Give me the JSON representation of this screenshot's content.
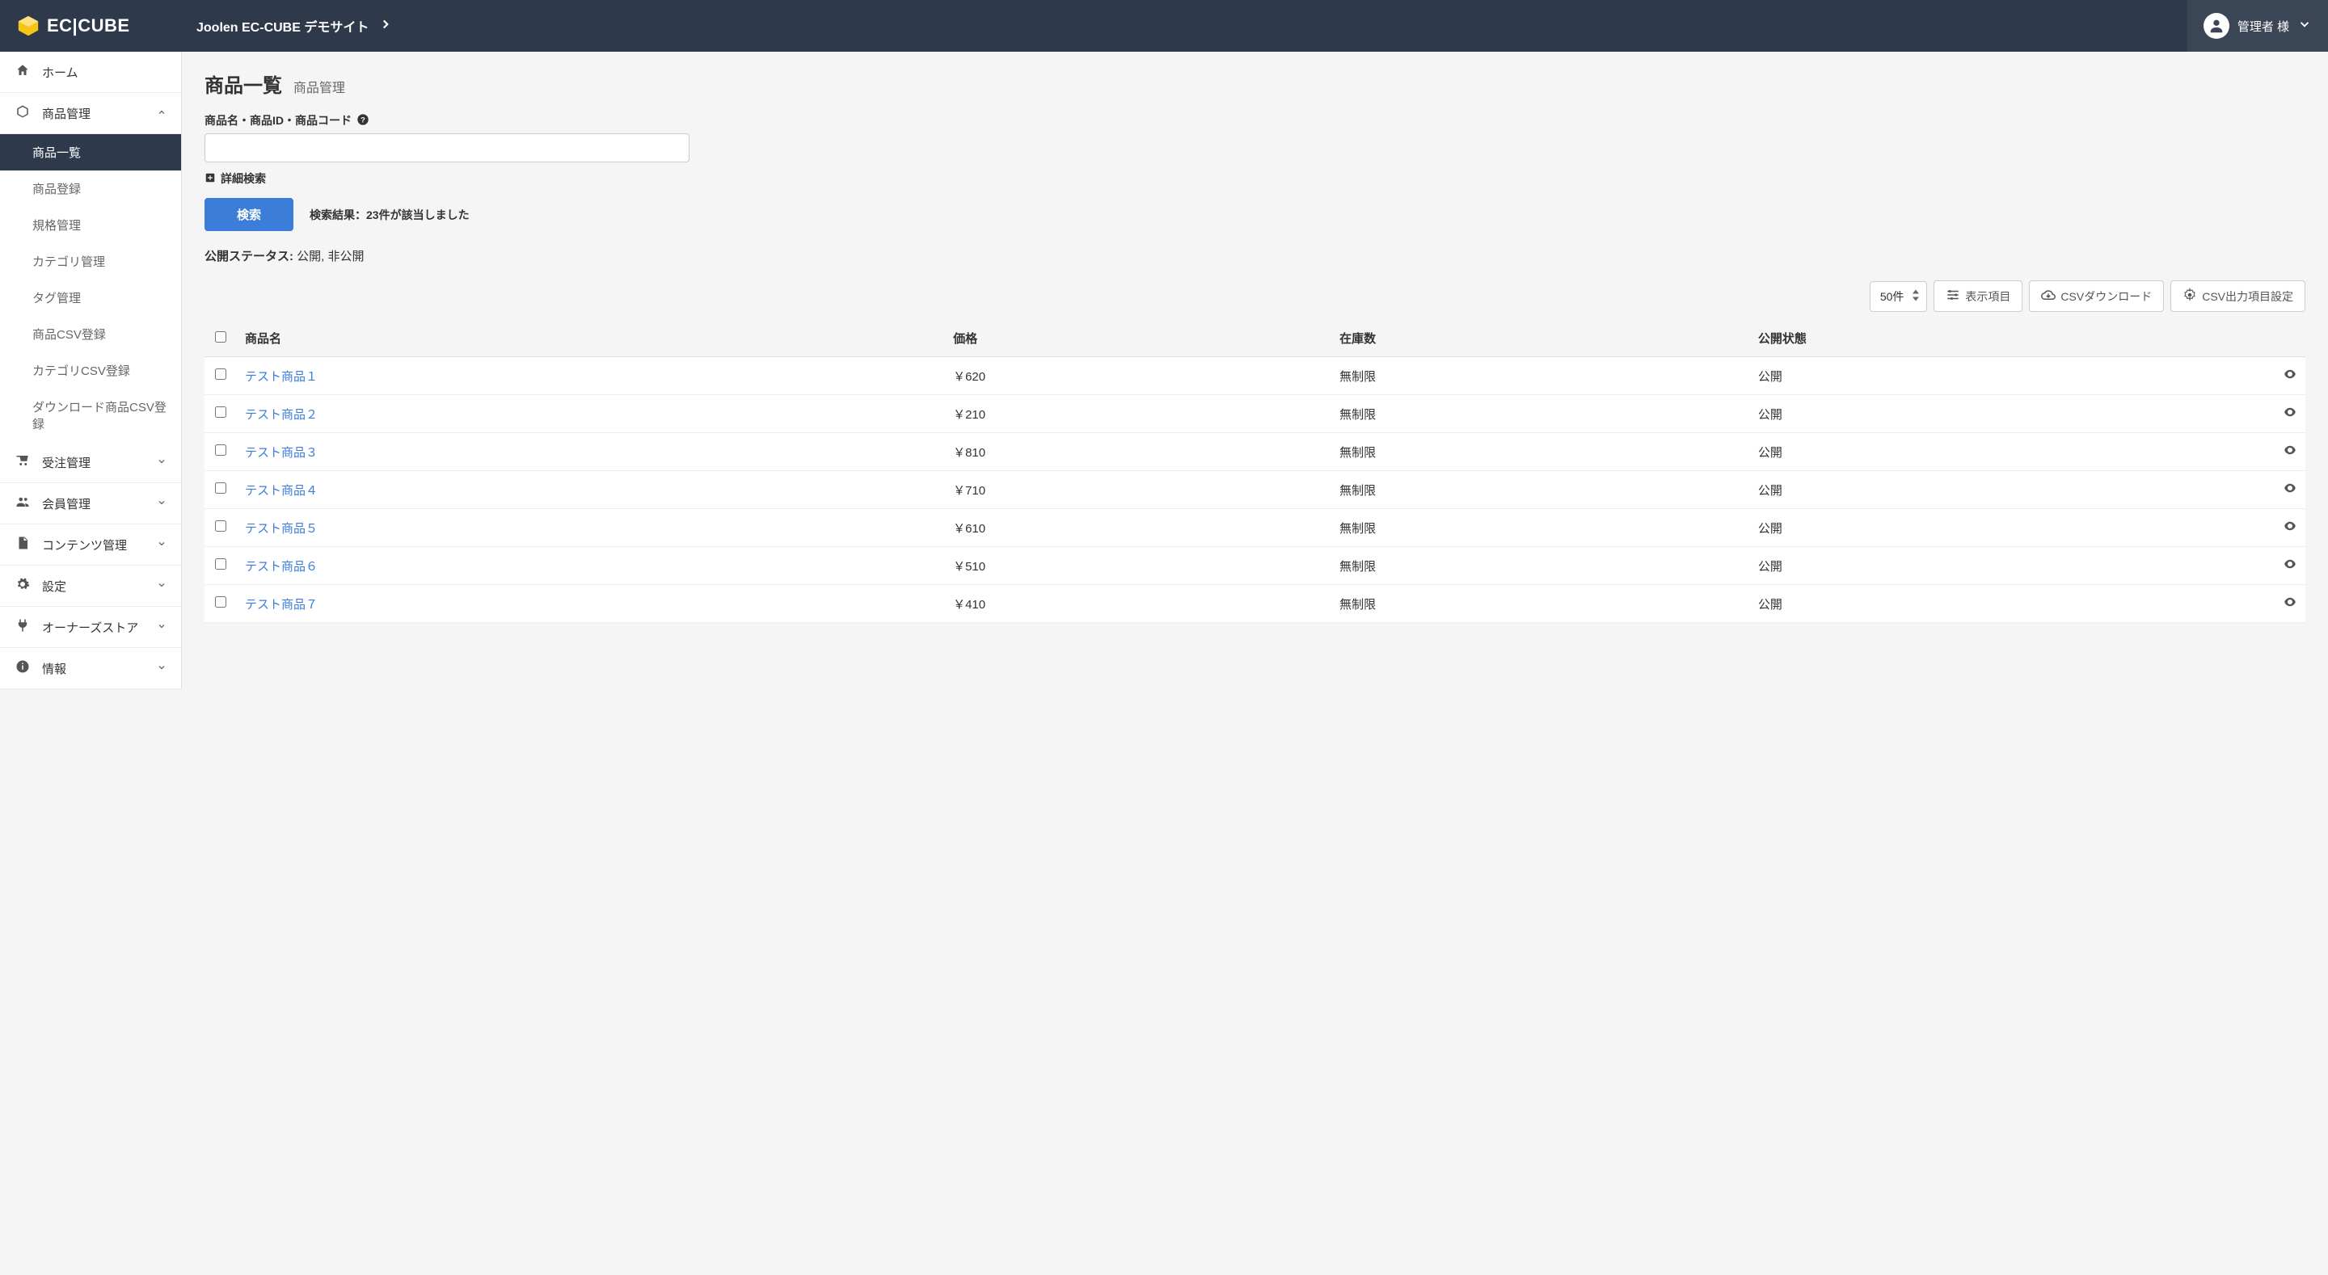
{
  "header": {
    "brand": "EC|CUBE",
    "site_name": "Joolen EC-CUBE デモサイト",
    "user_label": "管理者 様"
  },
  "sidebar": {
    "home": "ホーム",
    "product": "商品管理",
    "product_sub": [
      "商品一覧",
      "商品登録",
      "規格管理",
      "カテゴリ管理",
      "タグ管理",
      "商品CSV登録",
      "カテゴリCSV登録",
      "ダウンロード商品CSV登録"
    ],
    "order": "受注管理",
    "customer": "会員管理",
    "content": "コンテンツ管理",
    "setting": "設定",
    "store": "オーナーズストア",
    "info": "情報"
  },
  "page": {
    "title": "商品一覧",
    "subtitle": "商品管理"
  },
  "search": {
    "label": "商品名・商品ID・商品コード",
    "advanced": "詳細検索",
    "button": "検索",
    "result_prefix": "検索結果：",
    "result_count": "23",
    "result_suffix": "件が該当しました"
  },
  "status": {
    "label": "公開ステータス:",
    "value": "公開, 非公開"
  },
  "toolbar": {
    "per_page": "50件",
    "columns": "表示項目",
    "csv_download": "CSVダウンロード",
    "csv_settings": "CSV出力項目設定"
  },
  "table": {
    "headers": {
      "name": "商品名",
      "price": "価格",
      "stock": "在庫数",
      "status": "公開状態"
    },
    "rows": [
      {
        "name": "テスト商品１",
        "price": "￥620",
        "stock": "無制限",
        "status": "公開"
      },
      {
        "name": "テスト商品２",
        "price": "￥210",
        "stock": "無制限",
        "status": "公開"
      },
      {
        "name": "テスト商品３",
        "price": "￥810",
        "stock": "無制限",
        "status": "公開"
      },
      {
        "name": "テスト商品４",
        "price": "￥710",
        "stock": "無制限",
        "status": "公開"
      },
      {
        "name": "テスト商品５",
        "price": "￥610",
        "stock": "無制限",
        "status": "公開"
      },
      {
        "name": "テスト商品６",
        "price": "￥510",
        "stock": "無制限",
        "status": "公開"
      },
      {
        "name": "テスト商品７",
        "price": "￥410",
        "stock": "無制限",
        "status": "公開"
      }
    ]
  }
}
